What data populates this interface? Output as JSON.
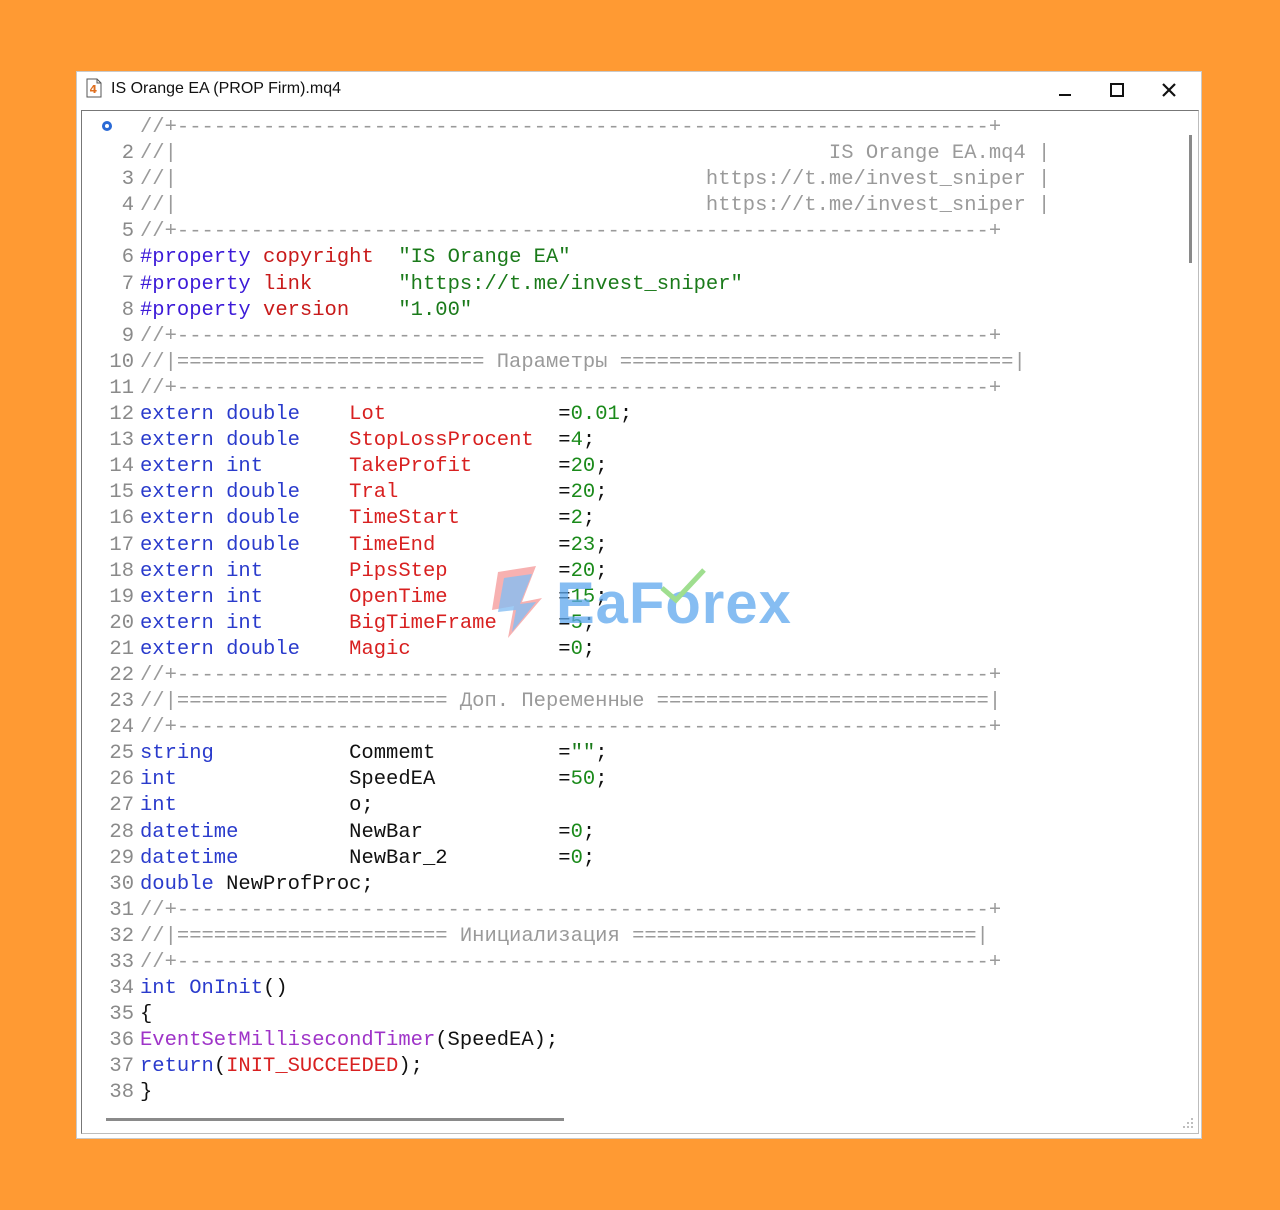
{
  "window": {
    "title": "IS Orange EA (PROP Firm).mq4",
    "icon": "mq4-file-icon",
    "controls": [
      "minimize-icon",
      "maximize-icon",
      "close-icon"
    ]
  },
  "watermark": {
    "text": "EaForex"
  },
  "colors": {
    "background": "#ff9a33",
    "keyword": "#2a3bcc",
    "comment": "#9a9a9a",
    "string": "#1a7a1a",
    "variable": "#d82020",
    "function": "#9f34c8"
  },
  "lines": [
    {
      "n": "",
      "marker": true,
      "tokens": [
        [
          "cm",
          "//+------------------------------------------------------------------+"
        ]
      ]
    },
    {
      "n": "2",
      "tokens": [
        [
          "cm",
          "//|                                                     IS Orange EA.mq4 |"
        ]
      ]
    },
    {
      "n": "3",
      "tokens": [
        [
          "cm",
          "//|                                           https://t.me/invest_sniper |"
        ]
      ]
    },
    {
      "n": "4",
      "tokens": [
        [
          "cm",
          "//|                                           https://t.me/invest_sniper |"
        ]
      ]
    },
    {
      "n": "5",
      "tokens": [
        [
          "cm",
          "//+------------------------------------------------------------------+"
        ]
      ]
    },
    {
      "n": "6",
      "tokens": [
        [
          "pp",
          "#property"
        ],
        [
          "op",
          " "
        ],
        [
          "prop",
          "copyright"
        ],
        [
          "op",
          "  "
        ],
        [
          "str",
          "\"IS Orange EA\""
        ]
      ]
    },
    {
      "n": "7",
      "tokens": [
        [
          "pp",
          "#property"
        ],
        [
          "op",
          " "
        ],
        [
          "prop",
          "link"
        ],
        [
          "op",
          "       "
        ],
        [
          "str",
          "\"https://t.me/invest_sniper\""
        ]
      ]
    },
    {
      "n": "8",
      "tokens": [
        [
          "pp",
          "#property"
        ],
        [
          "op",
          " "
        ],
        [
          "prop",
          "version"
        ],
        [
          "op",
          "    "
        ],
        [
          "str",
          "\"1.00\""
        ]
      ]
    },
    {
      "n": "9",
      "tokens": [
        [
          "cm",
          "//+------------------------------------------------------------------+"
        ]
      ]
    },
    {
      "n": "10",
      "tokens": [
        [
          "cm",
          "//|========================= Параметры ================================|"
        ]
      ]
    },
    {
      "n": "11",
      "tokens": [
        [
          "cm",
          "//+------------------------------------------------------------------+"
        ]
      ]
    },
    {
      "n": "12",
      "tokens": [
        [
          "kw",
          "extern double"
        ],
        [
          "op",
          "    "
        ],
        [
          "var",
          "Lot"
        ],
        [
          "op",
          "              ="
        ],
        [
          "num",
          "0.01"
        ],
        [
          "op",
          ";"
        ]
      ]
    },
    {
      "n": "13",
      "tokens": [
        [
          "kw",
          "extern double"
        ],
        [
          "op",
          "    "
        ],
        [
          "var",
          "StopLossProcent"
        ],
        [
          "op",
          "  ="
        ],
        [
          "num",
          "4"
        ],
        [
          "op",
          ";"
        ]
      ]
    },
    {
      "n": "14",
      "tokens": [
        [
          "kw",
          "extern int"
        ],
        [
          "op",
          "       "
        ],
        [
          "var",
          "TakeProfit"
        ],
        [
          "op",
          "       ="
        ],
        [
          "num",
          "20"
        ],
        [
          "op",
          ";"
        ]
      ]
    },
    {
      "n": "15",
      "tokens": [
        [
          "kw",
          "extern double"
        ],
        [
          "op",
          "    "
        ],
        [
          "var",
          "Tral"
        ],
        [
          "op",
          "             ="
        ],
        [
          "num",
          "20"
        ],
        [
          "op",
          ";"
        ]
      ]
    },
    {
      "n": "16",
      "tokens": [
        [
          "kw",
          "extern double"
        ],
        [
          "op",
          "    "
        ],
        [
          "var",
          "TimeStart"
        ],
        [
          "op",
          "        ="
        ],
        [
          "num",
          "2"
        ],
        [
          "op",
          ";"
        ]
      ]
    },
    {
      "n": "17",
      "tokens": [
        [
          "kw",
          "extern double"
        ],
        [
          "op",
          "    "
        ],
        [
          "var",
          "TimeEnd"
        ],
        [
          "op",
          "          ="
        ],
        [
          "num",
          "23"
        ],
        [
          "op",
          ";"
        ]
      ]
    },
    {
      "n": "18",
      "tokens": [
        [
          "kw",
          "extern int"
        ],
        [
          "op",
          "       "
        ],
        [
          "var",
          "PipsStep"
        ],
        [
          "op",
          "         ="
        ],
        [
          "num",
          "20"
        ],
        [
          "op",
          ";"
        ]
      ]
    },
    {
      "n": "19",
      "tokens": [
        [
          "kw",
          "extern int"
        ],
        [
          "op",
          "       "
        ],
        [
          "var",
          "OpenTime"
        ],
        [
          "op",
          "         ="
        ],
        [
          "num",
          "15"
        ],
        [
          "op",
          ";"
        ]
      ]
    },
    {
      "n": "20",
      "tokens": [
        [
          "kw",
          "extern int"
        ],
        [
          "op",
          "       "
        ],
        [
          "var",
          "BigTimeFrame"
        ],
        [
          "op",
          "     ="
        ],
        [
          "num",
          "5"
        ],
        [
          "op",
          ";"
        ]
      ]
    },
    {
      "n": "21",
      "tokens": [
        [
          "kw",
          "extern double"
        ],
        [
          "op",
          "    "
        ],
        [
          "var",
          "Magic"
        ],
        [
          "op",
          "            ="
        ],
        [
          "num",
          "0"
        ],
        [
          "op",
          ";"
        ]
      ]
    },
    {
      "n": "22",
      "tokens": [
        [
          "cm",
          "//+------------------------------------------------------------------+"
        ]
      ]
    },
    {
      "n": "23",
      "tokens": [
        [
          "cm",
          "//|====================== Доп. Переменные ===========================|"
        ]
      ]
    },
    {
      "n": "24",
      "tokens": [
        [
          "cm",
          "//+------------------------------------------------------------------+"
        ]
      ]
    },
    {
      "n": "25",
      "tokens": [
        [
          "kw",
          "string"
        ],
        [
          "op",
          "           Commemt          ="
        ],
        [
          "str",
          "\"\""
        ],
        [
          "op",
          ";"
        ]
      ]
    },
    {
      "n": "26",
      "tokens": [
        [
          "kw",
          "int"
        ],
        [
          "op",
          "              SpeedEA          ="
        ],
        [
          "num",
          "50"
        ],
        [
          "op",
          ";"
        ]
      ]
    },
    {
      "n": "27",
      "tokens": [
        [
          "kw",
          "int"
        ],
        [
          "op",
          "              o;"
        ]
      ]
    },
    {
      "n": "28",
      "tokens": [
        [
          "kw",
          "datetime"
        ],
        [
          "op",
          "         NewBar           ="
        ],
        [
          "num",
          "0"
        ],
        [
          "op",
          ";"
        ]
      ]
    },
    {
      "n": "29",
      "tokens": [
        [
          "kw",
          "datetime"
        ],
        [
          "op",
          "         NewBar_2         ="
        ],
        [
          "num",
          "0"
        ],
        [
          "op",
          ";"
        ]
      ]
    },
    {
      "n": "30",
      "tokens": [
        [
          "kw",
          "double"
        ],
        [
          "op",
          " NewProfProc;"
        ]
      ]
    },
    {
      "n": "31",
      "tokens": [
        [
          "cm",
          "//+------------------------------------------------------------------+"
        ]
      ]
    },
    {
      "n": "32",
      "tokens": [
        [
          "cm",
          "//|====================== Инициализация ============================|"
        ]
      ]
    },
    {
      "n": "33",
      "tokens": [
        [
          "cm",
          "//+------------------------------------------------------------------+"
        ]
      ]
    },
    {
      "n": "34",
      "tokens": [
        [
          "kw",
          "int"
        ],
        [
          "op",
          " "
        ],
        [
          "kw",
          "OnInit"
        ],
        [
          "op",
          "()"
        ]
      ]
    },
    {
      "n": "35",
      "tokens": [
        [
          "op",
          "{"
        ]
      ]
    },
    {
      "n": "36",
      "tokens": [
        [
          "fn",
          "EventSetMillisecondTimer"
        ],
        [
          "op",
          "(SpeedEA);"
        ]
      ]
    },
    {
      "n": "37",
      "tokens": [
        [
          "kw",
          "return"
        ],
        [
          "op",
          "("
        ],
        [
          "var",
          "INIT_SUCCEEDED"
        ],
        [
          "op",
          ");"
        ]
      ]
    },
    {
      "n": "38",
      "tokens": [
        [
          "op",
          "}"
        ]
      ]
    }
  ]
}
